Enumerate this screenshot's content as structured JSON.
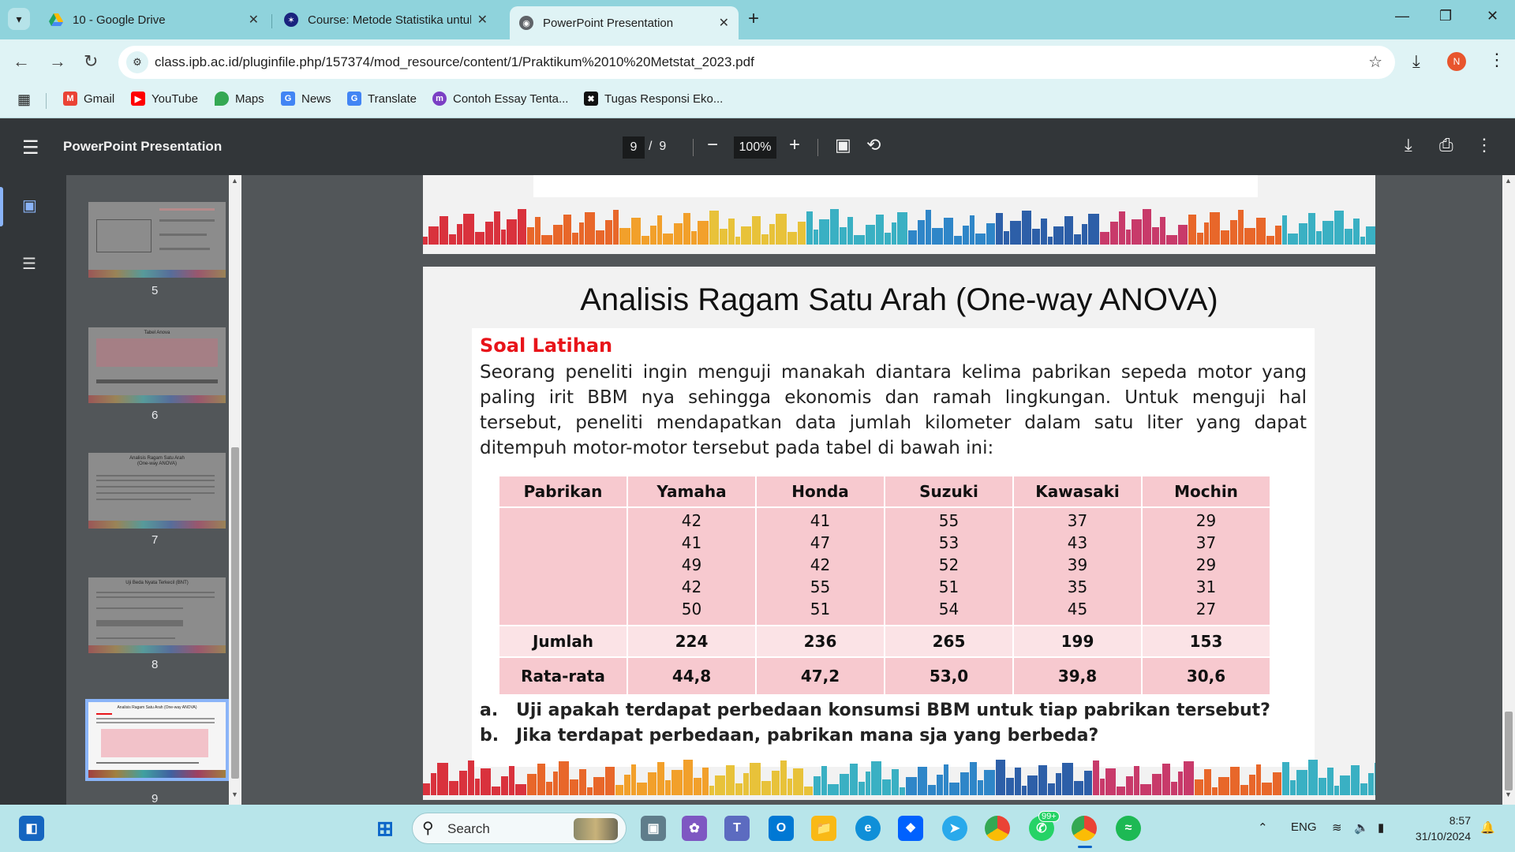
{
  "browser": {
    "tabs": [
      {
        "title": "10 - Google Drive",
        "icon": "google-drive-icon",
        "color": "#1fa463"
      },
      {
        "title": "Course: Metode Statistika untuk",
        "icon": "ipb-logo-icon",
        "color": "#1a237e"
      },
      {
        "title": "PowerPoint Presentation",
        "icon": "globe-icon",
        "color": "#5f6368",
        "active": true
      }
    ],
    "url": "class.ipb.ac.id/pluginfile.php/157374/mod_resource/content/1/Praktikum%2010%20Metstat_2023.pdf",
    "avatar_initial": "N",
    "bookmarks": [
      {
        "label": "Gmail",
        "icon": "gmail-icon",
        "color": "#ea4335"
      },
      {
        "label": "YouTube",
        "icon": "youtube-icon",
        "color": "#ff0000"
      },
      {
        "label": "Maps",
        "icon": "maps-icon",
        "color": "#34a853"
      },
      {
        "label": "News",
        "icon": "news-icon",
        "color": "#4285f4"
      },
      {
        "label": "Translate",
        "icon": "translate-icon",
        "color": "#4285f4"
      },
      {
        "label": "Contoh Essay Tenta...",
        "icon": "site-m-icon",
        "color": "#7b3fc4"
      },
      {
        "label": "Tugas Responsi Eko...",
        "icon": "site-x-icon",
        "color": "#111111"
      }
    ]
  },
  "viewer": {
    "title": "PowerPoint Presentation",
    "page_current": "9",
    "page_sep": "/",
    "page_total": "9",
    "zoom": "100%",
    "thumbnails": [
      {
        "label": "5"
      },
      {
        "label": "6"
      },
      {
        "label": "7"
      },
      {
        "label": "8"
      },
      {
        "label": "9",
        "current": true
      }
    ],
    "thumb_texts": {
      "t6": "Tabel Anova",
      "t7a": "Analisis Ragam Satu Arah",
      "t7b": "(One-way ANOVA)",
      "t8": "Uji Beda Nyata Terkecil (BNT)",
      "t9": "Analisis Ragam Satu Arah (One-way ANOVA)"
    }
  },
  "slide": {
    "title": "Analisis Ragam Satu Arah (One-way ANOVA)",
    "heading": "Soal Latihan",
    "paragraph": "Seorang peneliti ingin menguji manakah diantara kelima pabrikan sepeda motor yang paling irit BBM nya sehingga ekonomis dan ramah lingkungan. Untuk menguji hal tersebut, peneliti mendapatkan data jumlah kilometer dalam satu liter yang dapat ditempuh motor-motor tersebut pada tabel di bawah ini:",
    "table": {
      "headers": [
        "Pabrikan",
        "Yamaha",
        "Honda",
        "Suzuki",
        "Kawasaki",
        "Mochin"
      ],
      "values": {
        "yamaha": "42\n41\n49\n42\n50",
        "honda": "41\n47\n42\n55\n51",
        "suzuki": "55\n53\n52\n51\n54",
        "kawasaki": "37\n43\n39\n35\n45",
        "mochin": "29\n37\n29\n31\n27"
      },
      "sum_row": [
        "Jumlah",
        "224",
        "236",
        "265",
        "199",
        "153"
      ],
      "avg_row": [
        "Rata-rata",
        "44,8",
        "47,2",
        "53,0",
        "39,8",
        "30,6"
      ]
    },
    "questions": [
      {
        "letter": "a.",
        "text": "Uji apakah terdapat perbedaan konsumsi BBM untuk tiap pabrikan tersebut?"
      },
      {
        "letter": "b.",
        "text": "Jika terdapat perbedaan, pabrikan mana sja yang berbeda?"
      }
    ]
  },
  "taskbar": {
    "search_label": "Search",
    "whatsapp_badge": "99+",
    "language": "ENG",
    "time": "8:57",
    "date": "31/10/2024"
  }
}
